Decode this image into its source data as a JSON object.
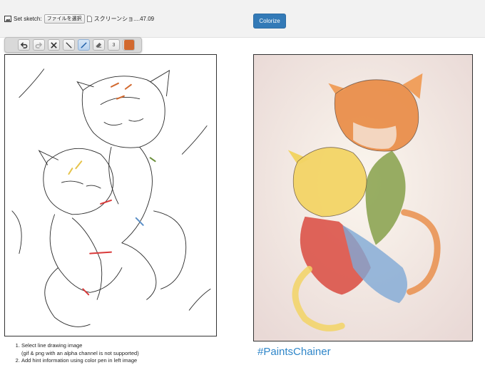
{
  "header": {
    "set_sketch_label": "Set sketch:",
    "file_button_label": "ファイルを選択",
    "file_name": "スクリーンショ....47.09",
    "colorize_label": "Colorize"
  },
  "toolbar": {
    "tools": [
      {
        "name": "undo-icon",
        "state": "enabled"
      },
      {
        "name": "redo-icon",
        "state": "disabled"
      },
      {
        "name": "clear-icon",
        "state": "enabled"
      },
      {
        "name": "line-icon",
        "state": "enabled"
      },
      {
        "name": "pen-icon",
        "state": "active"
      },
      {
        "name": "eraser-icon",
        "state": "enabled"
      }
    ],
    "brush_size": "3",
    "current_color": "#d2692f"
  },
  "instructions": {
    "step1": "Select line drawing image",
    "step1_note": "(gif & png with an alpha channel is not supported)",
    "step2": "Add hint information using color pen in left image"
  },
  "hashtag": "#PaintsChainer",
  "colors": {
    "accent": "#337ab7",
    "hashtag": "#2f86c9",
    "pen": "#d2692f"
  }
}
